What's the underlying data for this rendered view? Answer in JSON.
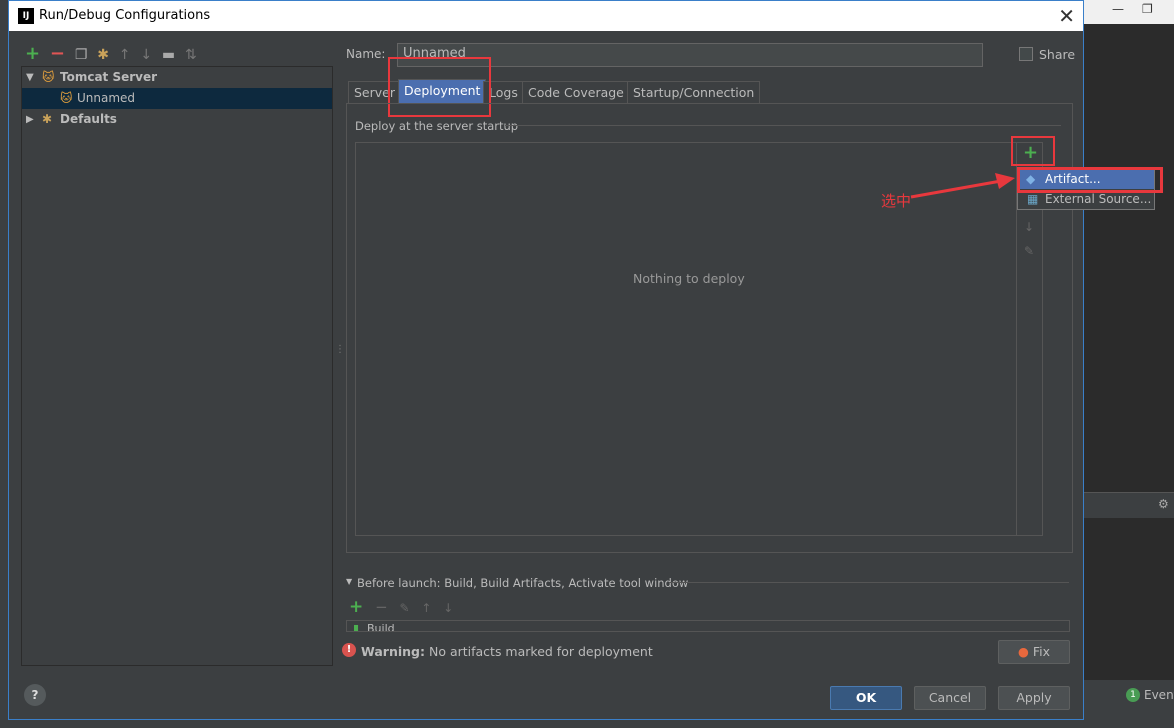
{
  "window": {
    "title": "Run/Debug Configurations",
    "close": "✕"
  },
  "tree": {
    "items": [
      {
        "label": "Tomcat Server"
      },
      {
        "label": "Unnamed"
      },
      {
        "label": "Defaults"
      }
    ]
  },
  "name": {
    "label": "Name:",
    "value": "Unnamed"
  },
  "share": {
    "label": "Share"
  },
  "tabs": [
    {
      "label": "Server"
    },
    {
      "label": "Deployment"
    },
    {
      "label": "Logs"
    },
    {
      "label": "Code Coverage"
    },
    {
      "label": "Startup/Connection"
    }
  ],
  "deployment": {
    "section": "Deploy at the server startup",
    "empty": "Nothing to deploy"
  },
  "popup": {
    "items": [
      {
        "label": "Artifact..."
      },
      {
        "label": "External Source..."
      }
    ]
  },
  "annotation": {
    "text": "选中",
    "color": "#e8383d"
  },
  "before_launch": {
    "label": "Before launch: Build, Build Artifacts, Activate tool window",
    "item": "Build"
  },
  "warning": {
    "bold": "Warning:",
    "text": "No artifacts marked for deployment"
  },
  "buttons": {
    "fix": "Fix",
    "ok": "OK",
    "cancel": "Cancel",
    "apply": "Apply",
    "help": "?"
  },
  "ide": {
    "event_log": "Event",
    "event_count": "1"
  },
  "colors": {
    "accent": "#4b6eaf",
    "annotation": "#e8383d",
    "add": "#4caf50"
  }
}
